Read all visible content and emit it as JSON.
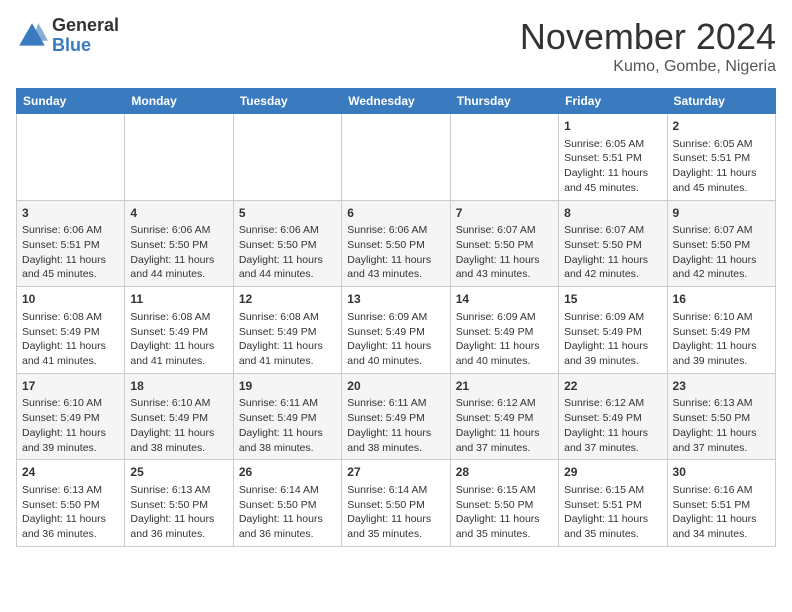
{
  "header": {
    "logo_general": "General",
    "logo_blue": "Blue",
    "month_title": "November 2024",
    "location": "Kumo, Gombe, Nigeria"
  },
  "weekdays": [
    "Sunday",
    "Monday",
    "Tuesday",
    "Wednesday",
    "Thursday",
    "Friday",
    "Saturday"
  ],
  "weeks": [
    [
      {
        "day": "",
        "info": ""
      },
      {
        "day": "",
        "info": ""
      },
      {
        "day": "",
        "info": ""
      },
      {
        "day": "",
        "info": ""
      },
      {
        "day": "",
        "info": ""
      },
      {
        "day": "1",
        "info": "Sunrise: 6:05 AM\nSunset: 5:51 PM\nDaylight: 11 hours\nand 45 minutes."
      },
      {
        "day": "2",
        "info": "Sunrise: 6:05 AM\nSunset: 5:51 PM\nDaylight: 11 hours\nand 45 minutes."
      }
    ],
    [
      {
        "day": "3",
        "info": "Sunrise: 6:06 AM\nSunset: 5:51 PM\nDaylight: 11 hours\nand 45 minutes."
      },
      {
        "day": "4",
        "info": "Sunrise: 6:06 AM\nSunset: 5:50 PM\nDaylight: 11 hours\nand 44 minutes."
      },
      {
        "day": "5",
        "info": "Sunrise: 6:06 AM\nSunset: 5:50 PM\nDaylight: 11 hours\nand 44 minutes."
      },
      {
        "day": "6",
        "info": "Sunrise: 6:06 AM\nSunset: 5:50 PM\nDaylight: 11 hours\nand 43 minutes."
      },
      {
        "day": "7",
        "info": "Sunrise: 6:07 AM\nSunset: 5:50 PM\nDaylight: 11 hours\nand 43 minutes."
      },
      {
        "day": "8",
        "info": "Sunrise: 6:07 AM\nSunset: 5:50 PM\nDaylight: 11 hours\nand 42 minutes."
      },
      {
        "day": "9",
        "info": "Sunrise: 6:07 AM\nSunset: 5:50 PM\nDaylight: 11 hours\nand 42 minutes."
      }
    ],
    [
      {
        "day": "10",
        "info": "Sunrise: 6:08 AM\nSunset: 5:49 PM\nDaylight: 11 hours\nand 41 minutes."
      },
      {
        "day": "11",
        "info": "Sunrise: 6:08 AM\nSunset: 5:49 PM\nDaylight: 11 hours\nand 41 minutes."
      },
      {
        "day": "12",
        "info": "Sunrise: 6:08 AM\nSunset: 5:49 PM\nDaylight: 11 hours\nand 41 minutes."
      },
      {
        "day": "13",
        "info": "Sunrise: 6:09 AM\nSunset: 5:49 PM\nDaylight: 11 hours\nand 40 minutes."
      },
      {
        "day": "14",
        "info": "Sunrise: 6:09 AM\nSunset: 5:49 PM\nDaylight: 11 hours\nand 40 minutes."
      },
      {
        "day": "15",
        "info": "Sunrise: 6:09 AM\nSunset: 5:49 PM\nDaylight: 11 hours\nand 39 minutes."
      },
      {
        "day": "16",
        "info": "Sunrise: 6:10 AM\nSunset: 5:49 PM\nDaylight: 11 hours\nand 39 minutes."
      }
    ],
    [
      {
        "day": "17",
        "info": "Sunrise: 6:10 AM\nSunset: 5:49 PM\nDaylight: 11 hours\nand 39 minutes."
      },
      {
        "day": "18",
        "info": "Sunrise: 6:10 AM\nSunset: 5:49 PM\nDaylight: 11 hours\nand 38 minutes."
      },
      {
        "day": "19",
        "info": "Sunrise: 6:11 AM\nSunset: 5:49 PM\nDaylight: 11 hours\nand 38 minutes."
      },
      {
        "day": "20",
        "info": "Sunrise: 6:11 AM\nSunset: 5:49 PM\nDaylight: 11 hours\nand 38 minutes."
      },
      {
        "day": "21",
        "info": "Sunrise: 6:12 AM\nSunset: 5:49 PM\nDaylight: 11 hours\nand 37 minutes."
      },
      {
        "day": "22",
        "info": "Sunrise: 6:12 AM\nSunset: 5:49 PM\nDaylight: 11 hours\nand 37 minutes."
      },
      {
        "day": "23",
        "info": "Sunrise: 6:13 AM\nSunset: 5:50 PM\nDaylight: 11 hours\nand 37 minutes."
      }
    ],
    [
      {
        "day": "24",
        "info": "Sunrise: 6:13 AM\nSunset: 5:50 PM\nDaylight: 11 hours\nand 36 minutes."
      },
      {
        "day": "25",
        "info": "Sunrise: 6:13 AM\nSunset: 5:50 PM\nDaylight: 11 hours\nand 36 minutes."
      },
      {
        "day": "26",
        "info": "Sunrise: 6:14 AM\nSunset: 5:50 PM\nDaylight: 11 hours\nand 36 minutes."
      },
      {
        "day": "27",
        "info": "Sunrise: 6:14 AM\nSunset: 5:50 PM\nDaylight: 11 hours\nand 35 minutes."
      },
      {
        "day": "28",
        "info": "Sunrise: 6:15 AM\nSunset: 5:50 PM\nDaylight: 11 hours\nand 35 minutes."
      },
      {
        "day": "29",
        "info": "Sunrise: 6:15 AM\nSunset: 5:51 PM\nDaylight: 11 hours\nand 35 minutes."
      },
      {
        "day": "30",
        "info": "Sunrise: 6:16 AM\nSunset: 5:51 PM\nDaylight: 11 hours\nand 34 minutes."
      }
    ]
  ]
}
